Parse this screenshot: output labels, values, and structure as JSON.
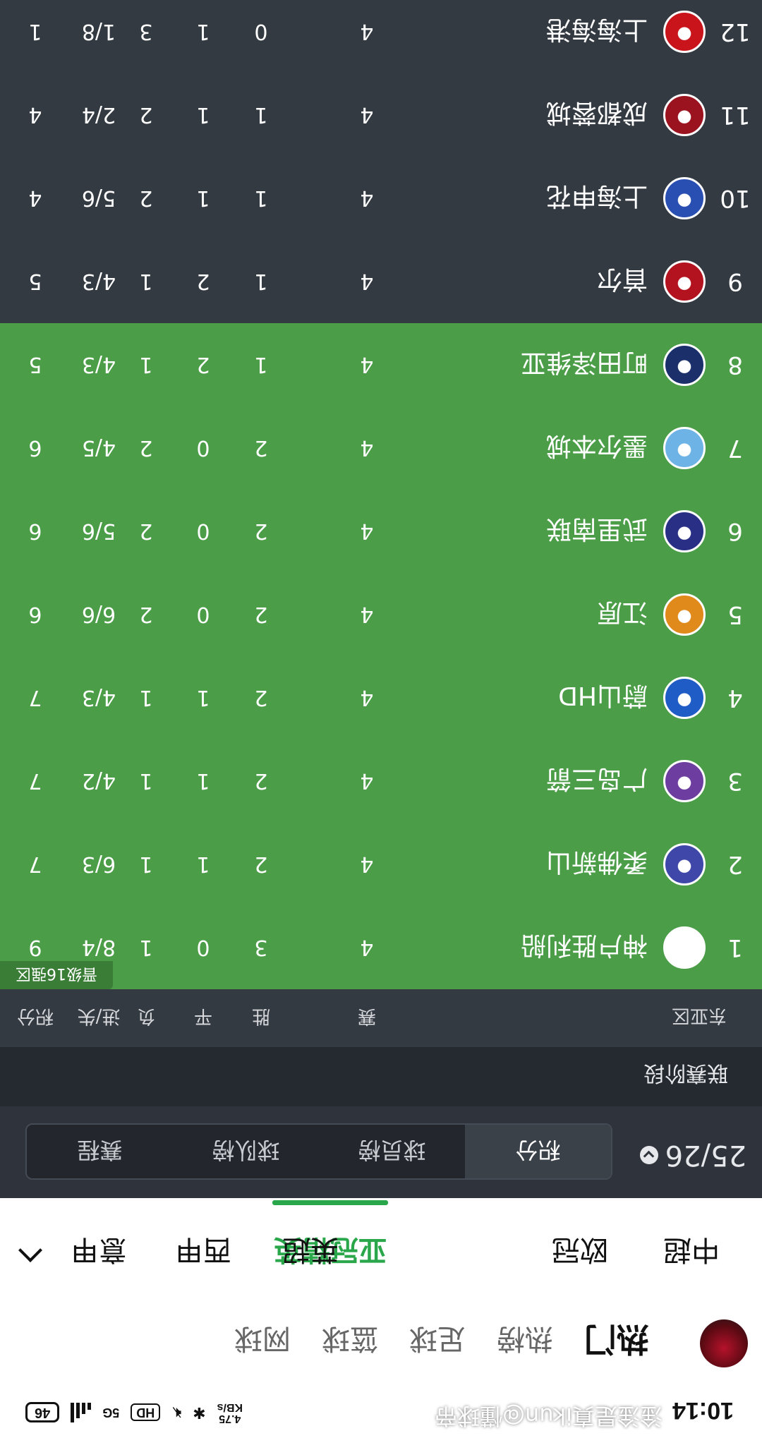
{
  "status_bar": {
    "time": "10:14",
    "net_speed_value": "4.75",
    "net_speed_unit": "KB/s",
    "hd_badge": "HD",
    "network_label": "5G",
    "battery": "46",
    "icons": [
      "bluetooth-icon",
      "mute-icon",
      "hd-icon",
      "signal-icon",
      "battery-icon"
    ]
  },
  "top_nav": {
    "tabs": [
      "热门",
      "热榜",
      "足球",
      "篮球",
      "网球"
    ],
    "active_tab": "热门"
  },
  "leagues": {
    "items": [
      "中超",
      "欧冠",
      "亚冠精英",
      "英超",
      "西甲",
      "意甲"
    ],
    "active": "亚冠精英",
    "accent_color": "#2aa74a"
  },
  "season": {
    "label": "25/26",
    "segments": [
      "积分",
      "球员榜",
      "球队榜",
      "赛程"
    ],
    "active_segment": "积分"
  },
  "stage": {
    "title": "联赛阶段"
  },
  "standings": {
    "group_name": "东亚区",
    "columns": [
      "赛",
      "胜",
      "平",
      "负",
      "进/失",
      "积分"
    ],
    "qualify_label": "晋级16强区",
    "qualify_color": "#4b9d48",
    "rows": [
      {
        "rank": "1",
        "team": "神户胜利船",
        "logo_color": "#ffffff",
        "played": "4",
        "w": "3",
        "d": "0",
        "l": "1",
        "gf_ga": "8/4",
        "pts": "9",
        "qualified": true
      },
      {
        "rank": "2",
        "team": "柔佛新山",
        "logo_color": "#3f48a8",
        "played": "4",
        "w": "2",
        "d": "1",
        "l": "1",
        "gf_ga": "6/3",
        "pts": "7",
        "qualified": true
      },
      {
        "rank": "3",
        "team": "广岛三箭",
        "logo_color": "#6d3ea0",
        "played": "4",
        "w": "2",
        "d": "1",
        "l": "1",
        "gf_ga": "4/2",
        "pts": "7",
        "qualified": true
      },
      {
        "rank": "4",
        "team": "蔚山HD",
        "logo_color": "#1f5cc6",
        "played": "4",
        "w": "2",
        "d": "1",
        "l": "1",
        "gf_ga": "4/3",
        "pts": "7",
        "qualified": true
      },
      {
        "rank": "5",
        "team": "江原",
        "logo_color": "#e08a1c",
        "played": "4",
        "w": "2",
        "d": "0",
        "l": "2",
        "gf_ga": "6/6",
        "pts": "6",
        "qualified": true
      },
      {
        "rank": "6",
        "team": "武里南联",
        "logo_color": "#2a2f86",
        "played": "4",
        "w": "2",
        "d": "0",
        "l": "2",
        "gf_ga": "5/6",
        "pts": "6",
        "qualified": true
      },
      {
        "rank": "7",
        "team": "墨尔本城",
        "logo_color": "#6eb3e6",
        "played": "4",
        "w": "2",
        "d": "0",
        "l": "2",
        "gf_ga": "4/5",
        "pts": "6",
        "qualified": true
      },
      {
        "rank": "8",
        "team": "町田泽维亚",
        "logo_color": "#1b2f6b",
        "played": "4",
        "w": "1",
        "d": "2",
        "l": "1",
        "gf_ga": "4/3",
        "pts": "5",
        "qualified": true
      },
      {
        "rank": "9",
        "team": "首尔",
        "logo_color": "#b3121f",
        "played": "4",
        "w": "1",
        "d": "2",
        "l": "1",
        "gf_ga": "4/3",
        "pts": "5",
        "qualified": false
      },
      {
        "rank": "10",
        "team": "上海申花",
        "logo_color": "#2a4fb3",
        "played": "4",
        "w": "1",
        "d": "1",
        "l": "2",
        "gf_ga": "5/6",
        "pts": "4",
        "qualified": false
      },
      {
        "rank": "11",
        "team": "成都蓉城",
        "logo_color": "#9c1320",
        "played": "4",
        "w": "1",
        "d": "1",
        "l": "2",
        "gf_ga": "2/4",
        "pts": "4",
        "qualified": false
      },
      {
        "rank": "12",
        "team": "上海海港",
        "logo_color": "#c9141b",
        "played": "4",
        "w": "0",
        "d": "1",
        "l": "3",
        "gf_ga": "1/8",
        "pts": "1",
        "qualified": false
      }
    ]
  },
  "watermark": "淦淦是真ikun@懂球帝"
}
